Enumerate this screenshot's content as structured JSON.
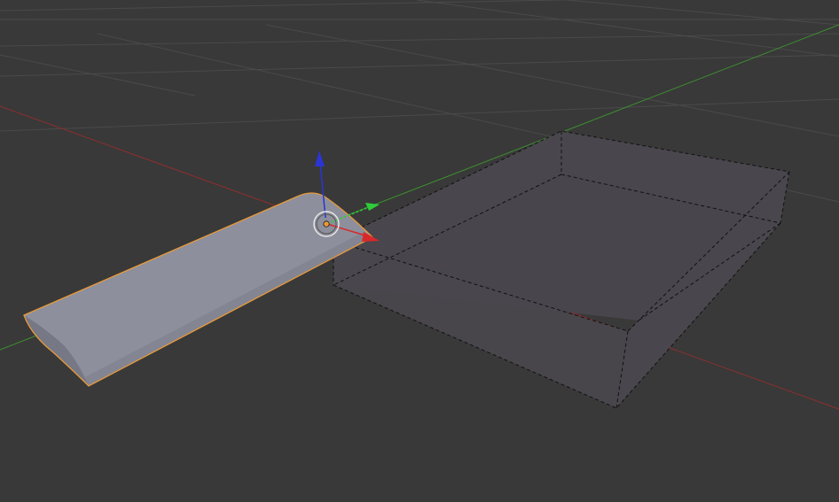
{
  "viewport": {
    "view": "3D Viewport",
    "background_color": "#393939",
    "grid_color": "#4a4a4a"
  },
  "axes": {
    "x_axis_color": "#8e2e2e",
    "y_axis_color": "#3d8f2f"
  },
  "objects": [
    {
      "id": "selected-object",
      "shape": "rounded-bar",
      "selected": true,
      "fill_color": "#8d8f9c",
      "outline_color": "#e89a3a"
    },
    {
      "id": "bounding-box-object",
      "shape": "hollow-tray",
      "selected": false,
      "display": "bounds-dashed",
      "fill_color": "#4a464d",
      "edge_color": "#111111"
    }
  ],
  "gizmo": {
    "x_handle_color": "#d8282a",
    "y_handle_color": "#2ecc3a",
    "z_handle_color": "#2b35d6",
    "origin_color": "#e89a3a",
    "ring_color": "#e6e6e6"
  }
}
